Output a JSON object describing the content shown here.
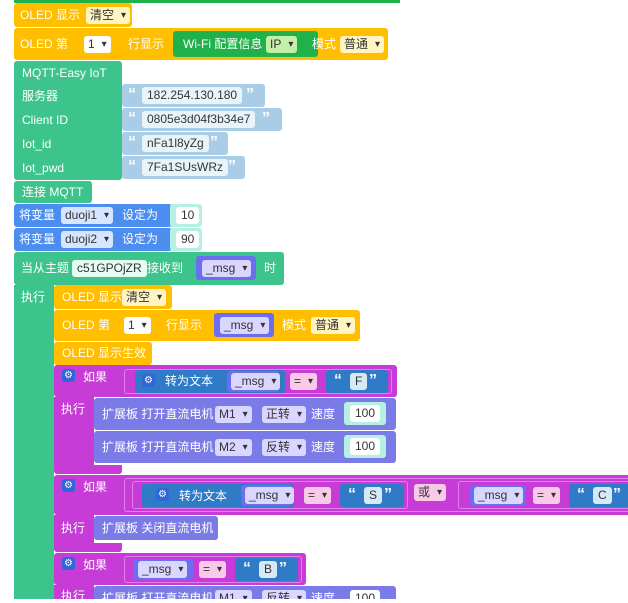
{
  "oled_clear": {
    "label": "OLED 显示",
    "mode": "清空"
  },
  "oled_line": {
    "label": "OLED 第",
    "line": "1",
    "suffix": "行显示",
    "wifi_block": "Wi-Fi 配置信息",
    "wifi_option": "IP",
    "mode_label": "模式",
    "mode": "普通"
  },
  "mqtt": {
    "title": "MQTT-Easy IoT",
    "fields": [
      {
        "label": "服务器",
        "value": "182.254.130.180"
      },
      {
        "label": "Client ID",
        "value": "0805e3d04f3b34e7"
      },
      {
        "label": "Iot_id",
        "value": "nFa1l8yZg"
      },
      {
        "label": "Iot_pwd",
        "value": "7Fa1SUsWRz"
      }
    ],
    "connect": "连接 MQTT"
  },
  "vars": [
    {
      "prefix": "将变量",
      "name": "duoji1",
      "set": "设定为",
      "value": "10"
    },
    {
      "prefix": "将变量",
      "name": "duoji2",
      "set": "设定为",
      "value": "90"
    }
  ],
  "subscribe": {
    "label": "当从主题",
    "topic": "c51GPOjZR",
    "received": "接收到",
    "var": "_msg",
    "tail": "时",
    "exec": "执行"
  },
  "handler": {
    "oled_clear": {
      "label": "OLED 显示",
      "mode": "清空"
    },
    "oled_line": {
      "label": "OLED 第",
      "line": "1",
      "suffix": "行显示",
      "var": "_msg",
      "mode_label": "模式",
      "mode": "普通"
    },
    "oled_show": "OLED 显示生效",
    "if_label": "如果",
    "exec_label": "执行",
    "if1": {
      "to_text": "转为文本",
      "var": "_msg",
      "op": "=",
      "str": "F"
    },
    "motor1": {
      "label": "扩展板 打开直流电机",
      "motor": "M1",
      "dir": "正转",
      "speed_label": "速度",
      "speed": "100"
    },
    "motor2": {
      "label": "扩展板 打开直流电机",
      "motor": "M2",
      "dir": "反转",
      "speed_label": "速度",
      "speed": "100"
    },
    "if2": {
      "to_text": "转为文本",
      "var": "_msg",
      "op": "=",
      "str": "S",
      "or": "或",
      "var2": "_msg",
      "op2": "=",
      "str2": "C"
    },
    "stop": "扩展板 关闭直流电机",
    "if3": {
      "var": "_msg",
      "op": "=",
      "str": "B"
    },
    "motor3": {
      "label": "扩展板 打开直流电机",
      "motor": "M1",
      "dir": "反转",
      "speed_label": "速度",
      "speed": "100"
    }
  },
  "colors": {
    "oled": "#ffbf00",
    "mqtt": "#3cc48c",
    "var": "#4c8ef0",
    "wifi": "#21b14b",
    "text": "#a9cde6",
    "logic": "#c73cd6",
    "motor": "#7b7be8",
    "msg": "#6d6df2"
  }
}
